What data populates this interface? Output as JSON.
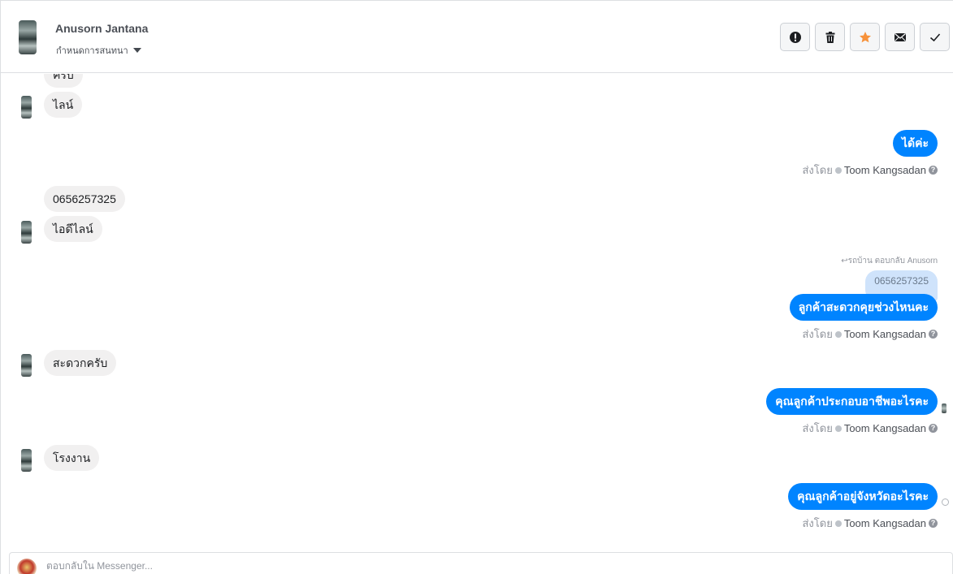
{
  "header": {
    "contact_name": "Anusorn Jantana",
    "subtitle": "กำหนดการสนทนา",
    "actions": [
      {
        "name": "mark-spam",
        "icon": "exclamation-icon"
      },
      {
        "name": "delete",
        "icon": "trash-icon"
      },
      {
        "name": "star",
        "icon": "star-icon",
        "color": "#f7923b"
      },
      {
        "name": "mark-unread",
        "icon": "envelope-icon"
      },
      {
        "name": "mark-done",
        "icon": "checkmark-icon"
      }
    ]
  },
  "messages": {
    "in_1": "ครับ",
    "in_2": "ไลน์",
    "out_1": "ได้ค่ะ",
    "in_3": "0656257325",
    "in_4": "ไอดีไลน์",
    "reply_note": "รถบ้าน ตอบกลับ Anusorn",
    "quoted": "0656257325",
    "out_2": "ลูกค้าสะดวกคุยช่วงไหนคะ",
    "in_5": "สะดวกครับ",
    "out_3": "คุณลูกค้าประกอบอาชีพอะไรคะ",
    "in_6": "โรงงาน",
    "out_4": "คุณลูกค้าอยู่จังหวัดอะไรคะ"
  },
  "sent_by": {
    "prefix": "ส่งโดย",
    "agent": "Toom Kangsadan"
  },
  "composer": {
    "placeholder": "ตอบกลับใน Messenger..."
  },
  "colors": {
    "outgoing_bubble": "#0084ff",
    "incoming_bubble": "#f1f0f0",
    "quoted_bubble": "#cfe3fb"
  }
}
